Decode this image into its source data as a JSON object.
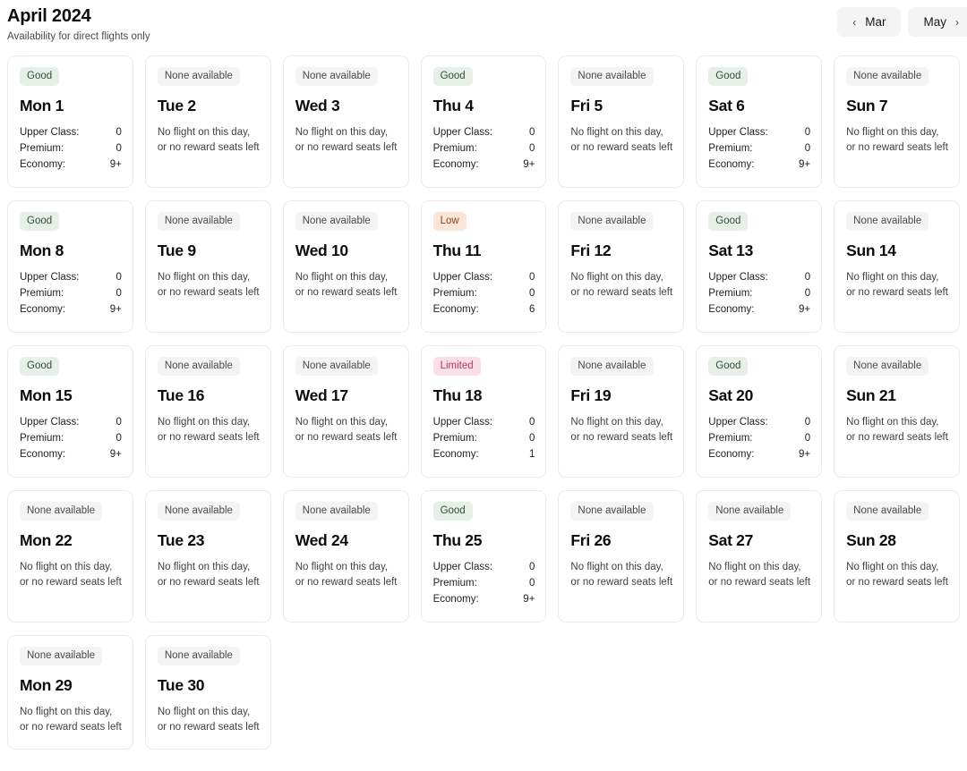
{
  "header": {
    "title": "April 2024",
    "subtitle": "Availability for direct flights only",
    "prev_button": {
      "label": "Mar",
      "icon": "chevron-left-icon",
      "glyph": "‹"
    },
    "next_button": {
      "label": "May",
      "icon": "chevron-right-icon",
      "glyph": "›"
    }
  },
  "colors": {
    "badge_good_bg": "#e7f0e8",
    "badge_good_text": "#2f4f35",
    "badge_low_bg": "#fbe5d6",
    "badge_low_text": "#8a4420",
    "badge_limited_bg": "#fadfe6",
    "badge_limited_text": "#b23a5c",
    "badge_none_bg": "#f4f4f5",
    "badge_none_text": "#4a4a4a",
    "card_border": "#ebebeb",
    "page_bg": "#ffffff"
  },
  "labels": {
    "upper_class": "Upper Class:",
    "premium": "Premium:",
    "economy": "Economy:",
    "no_flight_text": "No flight on this day, or no reward seats left",
    "none_available": "None available",
    "good": "Good",
    "low": "Low",
    "limited": "Limited"
  },
  "days": [
    {
      "day": "Mon 1",
      "status": "Good",
      "status_key": "good",
      "available": true,
      "cabins": {
        "upper_class": "0",
        "premium": "0",
        "economy": "9+"
      }
    },
    {
      "day": "Tue 2",
      "status": "None available",
      "status_key": "none",
      "available": false,
      "message": "No flight on this day, or no reward seats left"
    },
    {
      "day": "Wed 3",
      "status": "None available",
      "status_key": "none",
      "available": false,
      "message": "No flight on this day, or no reward seats left"
    },
    {
      "day": "Thu 4",
      "status": "Good",
      "status_key": "good",
      "available": true,
      "cabins": {
        "upper_class": "0",
        "premium": "0",
        "economy": "9+"
      }
    },
    {
      "day": "Fri 5",
      "status": "None available",
      "status_key": "none",
      "available": false,
      "message": "No flight on this day, or no reward seats left"
    },
    {
      "day": "Sat 6",
      "status": "Good",
      "status_key": "good",
      "available": true,
      "cabins": {
        "upper_class": "0",
        "premium": "0",
        "economy": "9+"
      }
    },
    {
      "day": "Sun 7",
      "status": "None available",
      "status_key": "none",
      "available": false,
      "message": "No flight on this day, or no reward seats left"
    },
    {
      "day": "Mon 8",
      "status": "Good",
      "status_key": "good",
      "available": true,
      "cabins": {
        "upper_class": "0",
        "premium": "0",
        "economy": "9+"
      }
    },
    {
      "day": "Tue 9",
      "status": "None available",
      "status_key": "none",
      "available": false,
      "message": "No flight on this day, or no reward seats left"
    },
    {
      "day": "Wed 10",
      "status": "None available",
      "status_key": "none",
      "available": false,
      "message": "No flight on this day, or no reward seats left"
    },
    {
      "day": "Thu 11",
      "status": "Low",
      "status_key": "low",
      "available": true,
      "cabins": {
        "upper_class": "0",
        "premium": "0",
        "economy": "6"
      }
    },
    {
      "day": "Fri 12",
      "status": "None available",
      "status_key": "none",
      "available": false,
      "message": "No flight on this day, or no reward seats left"
    },
    {
      "day": "Sat 13",
      "status": "Good",
      "status_key": "good",
      "available": true,
      "cabins": {
        "upper_class": "0",
        "premium": "0",
        "economy": "9+"
      }
    },
    {
      "day": "Sun 14",
      "status": "None available",
      "status_key": "none",
      "available": false,
      "message": "No flight on this day, or no reward seats left"
    },
    {
      "day": "Mon 15",
      "status": "Good",
      "status_key": "good",
      "available": true,
      "cabins": {
        "upper_class": "0",
        "premium": "0",
        "economy": "9+"
      }
    },
    {
      "day": "Tue 16",
      "status": "None available",
      "status_key": "none",
      "available": false,
      "message": "No flight on this day, or no reward seats left"
    },
    {
      "day": "Wed 17",
      "status": "None available",
      "status_key": "none",
      "available": false,
      "message": "No flight on this day, or no reward seats left"
    },
    {
      "day": "Thu 18",
      "status": "Limited",
      "status_key": "limited",
      "available": true,
      "cabins": {
        "upper_class": "0",
        "premium": "0",
        "economy": "1"
      }
    },
    {
      "day": "Fri 19",
      "status": "None available",
      "status_key": "none",
      "available": false,
      "message": "No flight on this day, or no reward seats left"
    },
    {
      "day": "Sat 20",
      "status": "Good",
      "status_key": "good",
      "available": true,
      "cabins": {
        "upper_class": "0",
        "premium": "0",
        "economy": "9+"
      }
    },
    {
      "day": "Sun 21",
      "status": "None available",
      "status_key": "none",
      "available": false,
      "message": "No flight on this day, or no reward seats left"
    },
    {
      "day": "Mon 22",
      "status": "None available",
      "status_key": "none",
      "available": false,
      "message": "No flight on this day, or no reward seats left"
    },
    {
      "day": "Tue 23",
      "status": "None available",
      "status_key": "none",
      "available": false,
      "message": "No flight on this day, or no reward seats left"
    },
    {
      "day": "Wed 24",
      "status": "None available",
      "status_key": "none",
      "available": false,
      "message": "No flight on this day, or no reward seats left"
    },
    {
      "day": "Thu 25",
      "status": "Good",
      "status_key": "good",
      "available": true,
      "cabins": {
        "upper_class": "0",
        "premium": "0",
        "economy": "9+"
      }
    },
    {
      "day": "Fri 26",
      "status": "None available",
      "status_key": "none",
      "available": false,
      "message": "No flight on this day, or no reward seats left"
    },
    {
      "day": "Sat 27",
      "status": "None available",
      "status_key": "none",
      "available": false,
      "message": "No flight on this day, or no reward seats left"
    },
    {
      "day": "Sun 28",
      "status": "None available",
      "status_key": "none",
      "available": false,
      "message": "No flight on this day, or no reward seats left"
    },
    {
      "day": "Mon 29",
      "status": "None available",
      "status_key": "none",
      "available": false,
      "message": "No flight on this day, or no reward seats left"
    },
    {
      "day": "Tue 30",
      "status": "None available",
      "status_key": "none",
      "available": false,
      "message": "No flight on this day, or no reward seats left"
    }
  ]
}
